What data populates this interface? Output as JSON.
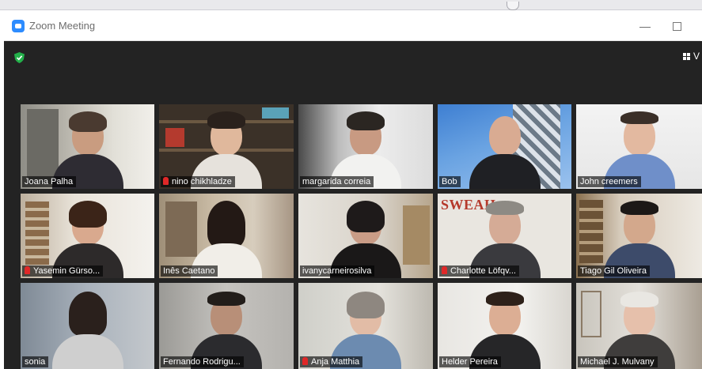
{
  "window": {
    "title": "Zoom Meeting",
    "minimize": "—"
  },
  "toolbar": {
    "view_label": "V"
  },
  "colors": {
    "accent": "#2d8cff",
    "active_speaker": "#d8d34a",
    "muted": "#e02828",
    "secure": "#23b04a"
  },
  "participants": [
    {
      "name": "Joana Palha",
      "muted": false
    },
    {
      "name": "nino chikhladze",
      "muted": true
    },
    {
      "name": "margarida correia",
      "muted": false
    },
    {
      "name": "Bob",
      "muted": false
    },
    {
      "name": "John creemers",
      "muted": false
    },
    {
      "name": "Yasemin Gürso...",
      "muted": true
    },
    {
      "name": "Inês Caetano",
      "muted": false,
      "active": true
    },
    {
      "name": "ivanycarneirosilva",
      "muted": false
    },
    {
      "name": "Charlotte Löfqv...",
      "muted": true
    },
    {
      "name": "Tiago Gil Oliveira",
      "muted": false
    },
    {
      "name": "sonia",
      "muted": false
    },
    {
      "name": "Fernando Rodrigu...",
      "muted": false
    },
    {
      "name": "Anja Matthia",
      "muted": true
    },
    {
      "name": "Helder Pereira",
      "muted": false
    },
    {
      "name": "Michael J. Mulvany",
      "muted": false
    }
  ],
  "sweah_logo": "SWEAH"
}
